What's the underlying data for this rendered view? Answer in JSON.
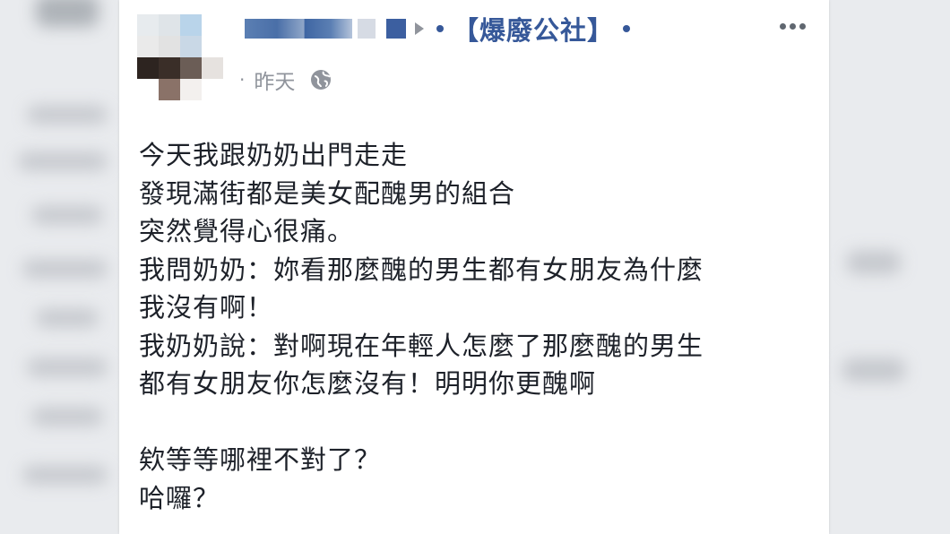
{
  "post": {
    "group_name": "【爆廢公社】",
    "timestamp": "昨天",
    "audience_icon": "globe-icon",
    "more_icon": "more-options-icon",
    "body_lines": [
      "今天我跟奶奶出門走走",
      "發現滿街都是美女配醜男的組合",
      "突然覺得心很痛。",
      "我問奶奶：妳看那麼醜的男生都有女朋友為什麼",
      "我沒有啊！",
      "我奶奶說：對啊現在年輕人怎麼了那麼醜的男生",
      "都有女朋友你怎麼沒有！明明你更醜啊",
      "",
      "欸等等哪裡不對了？",
      "哈囉？"
    ]
  },
  "colors": {
    "link": "#365899",
    "meta": "#90949c",
    "text": "#1d2129",
    "page_bg": "#e9ebee"
  }
}
